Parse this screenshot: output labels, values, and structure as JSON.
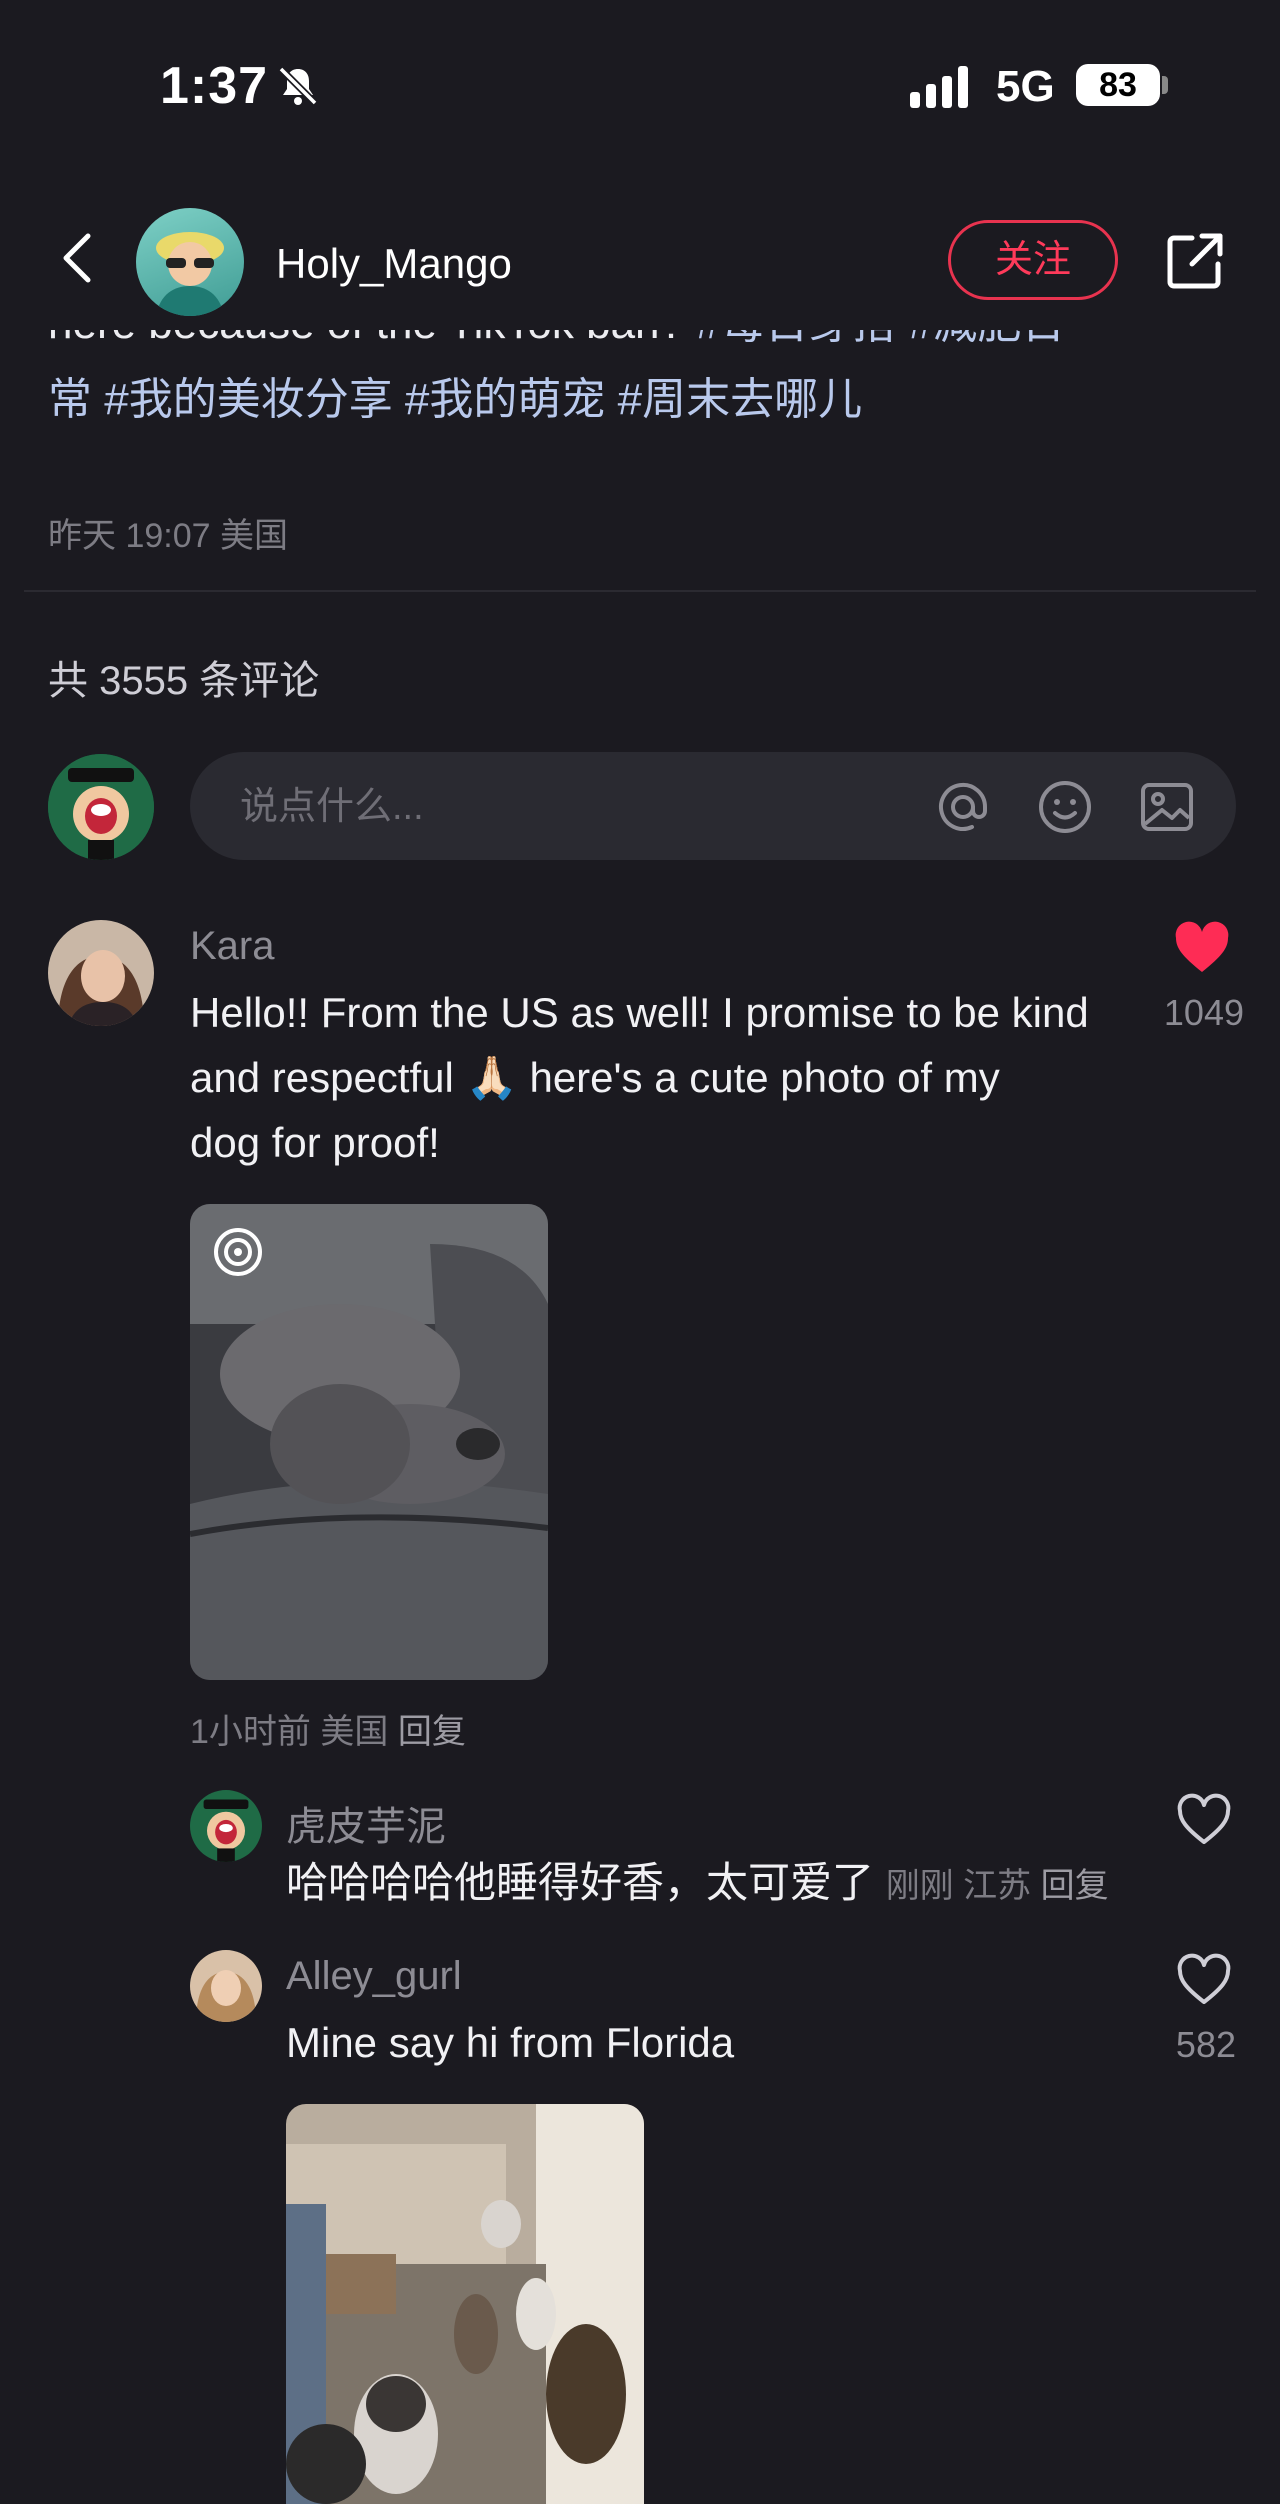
{
  "status_bar": {
    "time": "1:37",
    "network": "5G",
    "battery": "83"
  },
  "header": {
    "author": "Holy_Mango",
    "follow_label": "关注"
  },
  "post": {
    "text_line1_plain": "here because of the TikTok ban?",
    "text_line1_tags": " #每日穿搭  #减肥日",
    "text_line2_tags": "常  #我的美妆分享  #我的萌宠  #周末去哪儿",
    "meta": "昨天 19:07 美国"
  },
  "comments_count": "共 3555 条评论",
  "input": {
    "placeholder": "说点什么..."
  },
  "comments": [
    {
      "name": "Kara",
      "text": "Hello!! From the US as well! I promise to be kind and respectful 🙏🏻 here's a cute photo of my dog for proof!",
      "line1": "Hello!! From the US as well! I promise to be kind",
      "line2": "and respectful 🙏🏻 here's a cute photo of my",
      "line3": "dog for proof!",
      "likes": "1049",
      "liked": true,
      "meta_time": "1小时前",
      "meta_loc": "美国",
      "reply_label": "回复"
    }
  ],
  "replies": [
    {
      "name": "虎皮芋泥",
      "text": "哈哈哈哈他睡得好香，太可爱了",
      "meta_time": "刚刚",
      "meta_loc": "江苏",
      "reply_label": "回复"
    },
    {
      "name": "Alley_gurl",
      "text": "Mine say hi from Florida",
      "likes": "582"
    }
  ],
  "colors": {
    "accent": "#ff3a5a",
    "background": "#1b1a20",
    "tag": "#b9c9ec"
  }
}
